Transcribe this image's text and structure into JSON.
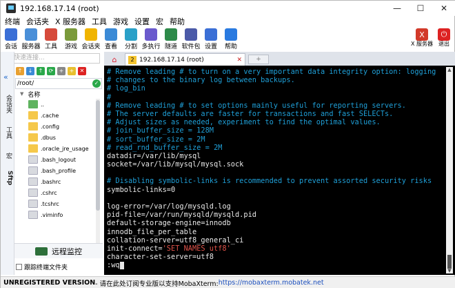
{
  "window": {
    "title": "192.168.17.14 (root)",
    "controls": [
      "—",
      "☐",
      "✕"
    ]
  },
  "menu": [
    "终端",
    "会话夹",
    "X 服务器",
    "工具",
    "游戏",
    "设置",
    "宏",
    "帮助"
  ],
  "toolbar": [
    {
      "label": "会话",
      "icon": "session-icon",
      "color": "#3b6fd6"
    },
    {
      "label": "服务器",
      "icon": "servers-icon",
      "color": "#4a8fd8"
    },
    {
      "label": "工具",
      "icon": "tools-icon",
      "color": "#d64a3b"
    },
    {
      "label": "游戏",
      "icon": "games-icon",
      "color": "#7a9a3b"
    },
    {
      "label": "会话夹",
      "icon": "star-icon",
      "color": "#f0b400"
    },
    {
      "label": "查看",
      "icon": "view-icon",
      "color": "#3b8ad6"
    },
    {
      "label": "分割",
      "icon": "split-icon",
      "color": "#2aa0c8"
    },
    {
      "label": "多执行",
      "icon": "multiexec-icon",
      "color": "#6a5acd"
    },
    {
      "label": "隧道",
      "icon": "tunnel-icon",
      "color": "#2d8a4a"
    },
    {
      "label": "软件包",
      "icon": "packages-icon",
      "color": "#4b5aa8"
    },
    {
      "label": "设置",
      "icon": "settings-icon",
      "color": "#3b6fd6"
    },
    {
      "label": "帮助",
      "icon": "help-icon",
      "color": "#2a7ae0"
    }
  ],
  "toolbar_right": [
    {
      "label": "X 服务器",
      "icon": "x-server-icon",
      "color": "#d23a2a"
    },
    {
      "label": "退出",
      "icon": "exit-icon",
      "color": "#d22"
    }
  ],
  "quick_connect": {
    "placeholder": "快速连接..."
  },
  "side_nav": [
    "会话夹",
    "工具",
    "宏",
    "Sftp"
  ],
  "sftp": {
    "path": "/root/",
    "column": "名称",
    "files": [
      {
        "name": "..",
        "type": "up"
      },
      {
        "name": ".cache",
        "type": "folder"
      },
      {
        "name": ".config",
        "type": "folder"
      },
      {
        "name": ".dbus",
        "type": "folder"
      },
      {
        "name": ".oracle_jre_usage",
        "type": "folder"
      },
      {
        "name": ".bash_logout",
        "type": "file"
      },
      {
        "name": ".bash_profile",
        "type": "file"
      },
      {
        "name": ".bashrc",
        "type": "file"
      },
      {
        "name": ".cshrc",
        "type": "file"
      },
      {
        "name": ".tcshrc",
        "type": "file"
      },
      {
        "name": ".viminfo",
        "type": "file"
      }
    ],
    "remote_monitor": "远程监控",
    "follow_folder": "跟踪终端文件夹"
  },
  "tabs": {
    "active_number": "2",
    "active_title": "192.168.17.14 (root)"
  },
  "terminal": {
    "lines": [
      [
        {
          "t": "# Remove leading # to turn on a very important data integrity option: logging",
          "c": "c"
        }
      ],
      [
        {
          "t": "# changes to the binary log between backups.",
          "c": "c"
        }
      ],
      [
        {
          "t": "# log_bin",
          "c": "c"
        }
      ],
      [
        {
          "t": "#",
          "c": "c"
        }
      ],
      [
        {
          "t": "# Remove leading # to set options mainly useful for reporting servers.",
          "c": "c"
        }
      ],
      [
        {
          "t": "# The server defaults are faster for transactions and fast SELECTs.",
          "c": "c"
        }
      ],
      [
        {
          "t": "# Adjust sizes as needed, experiment to find the optimal values.",
          "c": "c"
        }
      ],
      [
        {
          "t": "# join_buffer_size = 128M",
          "c": "c"
        }
      ],
      [
        {
          "t": "# sort_buffer_size = 2M",
          "c": "c"
        }
      ],
      [
        {
          "t": "# read_rnd_buffer_size = 2M",
          "c": "c"
        }
      ],
      [
        {
          "t": "datadir=/var/lib/mysql",
          "c": "w"
        }
      ],
      [
        {
          "t": "socket=/var/lib/mysql/mysql.sock",
          "c": "w"
        }
      ],
      [
        {
          "t": "",
          "c": "w"
        }
      ],
      [
        {
          "t": "# Disabling symbolic-links is recommended to prevent assorted security risks",
          "c": "c"
        }
      ],
      [
        {
          "t": "symbolic-links=0",
          "c": "w"
        }
      ],
      [
        {
          "t": "",
          "c": "w"
        }
      ],
      [
        {
          "t": "log-error=/var/log/mysqld.log",
          "c": "w"
        }
      ],
      [
        {
          "t": "pid-file=/var/run/mysqld/mysqld.pid",
          "c": "w"
        }
      ],
      [
        {
          "t": "default-storage-engine=innodb",
          "c": "w"
        }
      ],
      [
        {
          "t": "innodb_file_per_table",
          "c": "w"
        }
      ],
      [
        {
          "t": "collation-server=utf8_general_ci",
          "c": "w"
        }
      ],
      [
        {
          "t": "init-connect=",
          "c": "w"
        },
        {
          "t": "'SET NAMES utf8'",
          "c": "s"
        }
      ],
      [
        {
          "t": "character-set-server=utf8",
          "c": "w"
        }
      ],
      [
        {
          "t": ":wq",
          "c": "w"
        }
      ]
    ]
  },
  "status": {
    "unregistered": "UNREGISTERED VERSION",
    "message": " - 请在此处订阅专业版以支持MobaXterm: ",
    "url": "https://mobaxterm.mobatek.net"
  }
}
